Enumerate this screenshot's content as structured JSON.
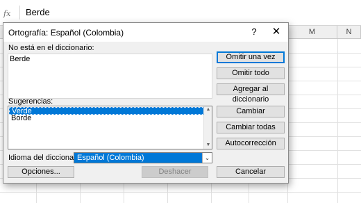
{
  "formula_bar": {
    "fx": "fx",
    "value": "Berde"
  },
  "grid": {
    "columns": [
      "M",
      "N"
    ]
  },
  "dialog": {
    "title": "Ortografía: Español (Colombia)",
    "help": "?",
    "close": "✕",
    "not_in_dict_label": "No está en el diccionario:",
    "not_in_dict_value": "Berde",
    "suggestions_label": "Sugerencias:",
    "suggestions": [
      "Verde",
      "Borde"
    ],
    "dict_lang_label": "Idioma del diccionario:",
    "dict_lang_value": "Español (Colombia)",
    "buttons": {
      "ignore_once": "Omitir una vez",
      "ignore_all": "Omitir todo",
      "add_to_dict": "Agregar al diccionario",
      "change": "Cambiar",
      "change_all": "Cambiar todas",
      "autocorrect": "Autocorrección",
      "options": "Opciones...",
      "undo": "Deshacer",
      "cancel": "Cancelar"
    }
  }
}
